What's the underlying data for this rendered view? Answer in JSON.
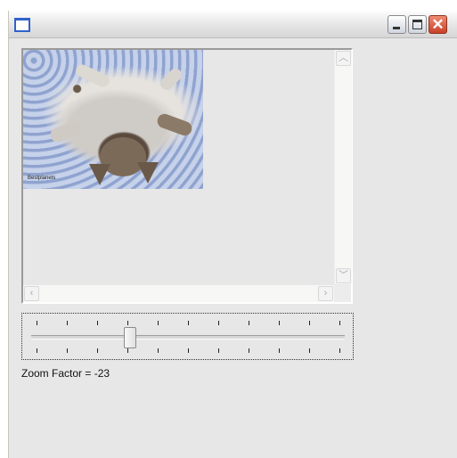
{
  "window": {
    "title": "",
    "icon": "window-icon",
    "controls": {
      "minimize_icon": "minimize-icon",
      "maximize_icon": "maximize-icon",
      "close_icon": "close-icon",
      "close_glyph": "✕"
    }
  },
  "image_view": {
    "image_content": "kitten-lying-on-back-photo",
    "watermark": "Bestplanets",
    "scroll_up_glyph": "︿",
    "scroll_down_glyph": "﹀",
    "scroll_left_glyph": "‹",
    "scroll_right_glyph": "›"
  },
  "slider": {
    "tick_count": 11,
    "position_fraction": 0.31
  },
  "zoom_label": "Zoom Factor = -23",
  "colors": {
    "close_button": "#c8402a",
    "client_background": "#e7e7e7"
  }
}
